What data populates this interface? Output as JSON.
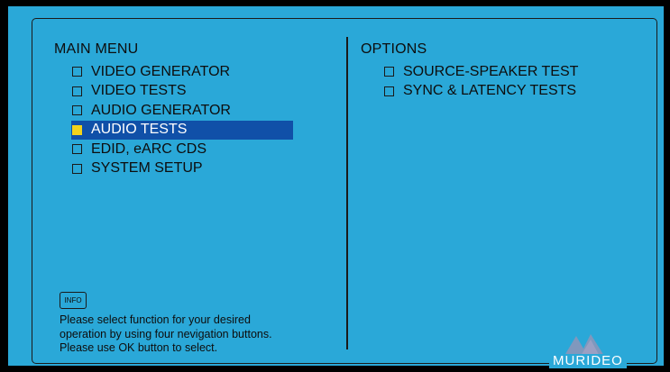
{
  "main_menu": {
    "title": "MAIN MENU",
    "items": [
      {
        "label": "VIDEO GENERATOR",
        "selected": false
      },
      {
        "label": "VIDEO TESTS",
        "selected": false
      },
      {
        "label": "AUDIO GENERATOR",
        "selected": false
      },
      {
        "label": "AUDIO TESTS",
        "selected": true
      },
      {
        "label": "EDID, eARC CDS",
        "selected": false
      },
      {
        "label": "SYSTEM SETUP",
        "selected": false
      }
    ]
  },
  "options": {
    "title": "OPTIONS",
    "items": [
      {
        "label": "SOURCE-SPEAKER TEST"
      },
      {
        "label": "SYNC & LATENCY TESTS"
      }
    ]
  },
  "info_button": {
    "label": "INFO"
  },
  "help_text": {
    "lines": [
      "Please select function for your desired",
      "operation by using four nevigation buttons.",
      "Please use OK button to select."
    ]
  },
  "brand": {
    "name": "MURIDEO"
  },
  "colors": {
    "background": "#2aa8d8",
    "selection": "#1050a8",
    "selected_checkbox": "#f2d21b",
    "text": "#0d0d0d"
  }
}
